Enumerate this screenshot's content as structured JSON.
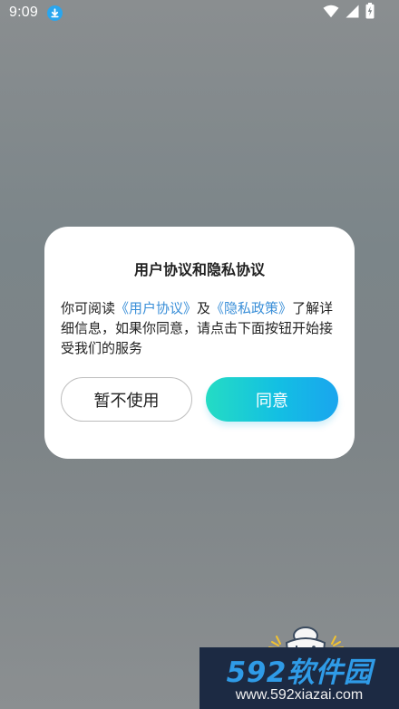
{
  "status_bar": {
    "time": "9:09"
  },
  "dialog": {
    "title": "用户协议和隐私协议",
    "message_lead": "你可阅读",
    "user_agreement_link": "《用户协议》",
    "message_connector": "及",
    "privacy_policy_link": "《隐私政策》",
    "message_tail": "了解详细信息，如果你同意，请点击下面按钮开始接受我们的服务",
    "decline_button": "暂不使用",
    "agree_button": "同意"
  },
  "watermark": {
    "brand": "592软件园",
    "url": "www.592xiazai.com"
  },
  "colors": {
    "link": "#3a8fd8",
    "agree_gradient_start": "#24dcc4",
    "agree_gradient_end": "#1aa5ee",
    "overlay": "#7d8487",
    "watermark_bg": "#1c2a43"
  },
  "icons": {
    "download": "download-icon",
    "wifi": "wifi-icon",
    "signal": "cellular-signal-icon",
    "battery": "battery-charging-icon",
    "mascot": "game-controller-mascot-icon"
  }
}
